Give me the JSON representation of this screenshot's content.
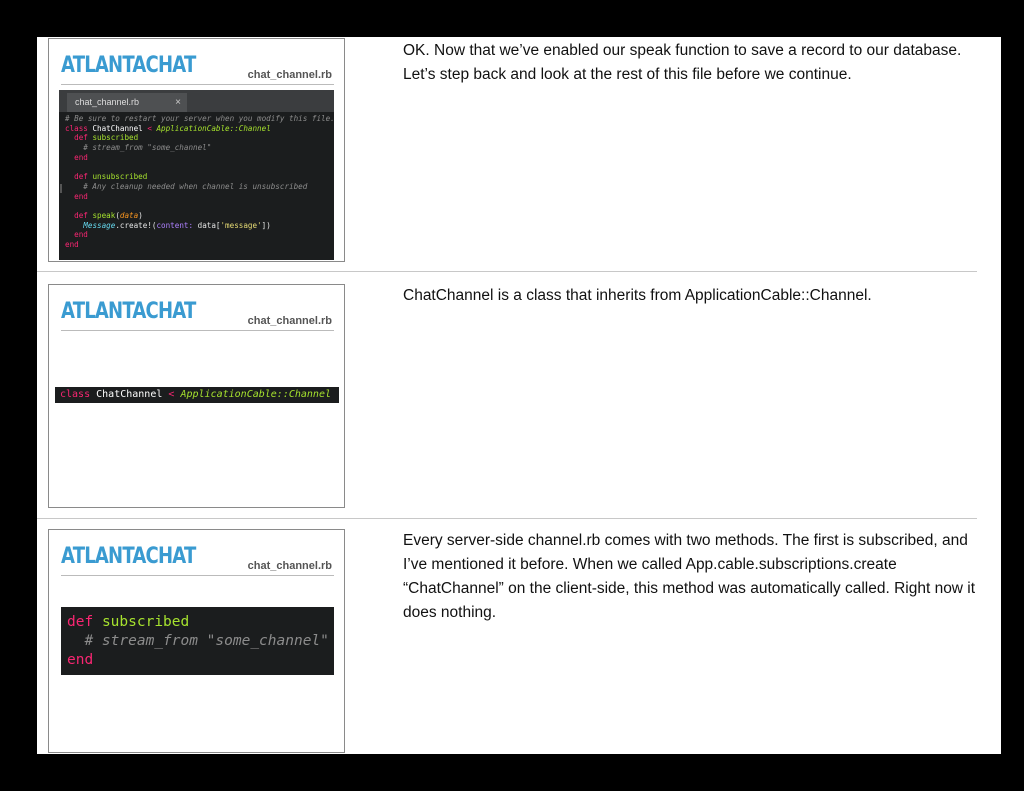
{
  "slides": [
    {
      "brand": "ATLANTACHAT",
      "filename": "chat_channel.rb",
      "editor_tab": "chat_channel.rb",
      "tab_close": "×",
      "code_lines": [
        "# Be sure to restart your server when you modify this file.",
        "class ChatChannel < ApplicationCable::Channel",
        "  def subscribed",
        "    # stream_from \"some_channel\"",
        "  end",
        "",
        "  def unsubscribed",
        "    # Any cleanup needed when channel is unsubscribed",
        "  end",
        "",
        "  def speak(data)",
        "    Message.create!(content: data['message'])",
        "  end",
        "end"
      ],
      "notes": "OK.  Now that we’ve enabled our speak function to save a record to our database. Let’s step back and look at the rest of this file before we continue."
    },
    {
      "brand": "ATLANTACHAT",
      "filename": "chat_channel.rb",
      "code_line": "class ChatChannel < ApplicationCable::Channel",
      "notes": "ChatChannel is a class that inherits from ApplicationCable::Channel."
    },
    {
      "brand": "ATLANTACHAT",
      "filename": "chat_channel.rb",
      "code_lines": [
        "def subscribed",
        "  # stream_from \"some_channel\"",
        "end"
      ],
      "notes": "Every server-side channel.rb comes with two methods. The first is subscribed, and I’ve mentioned it before. When we called App.cable.subscriptions.create “ChatChannel” on the client-side, this method was automatically called. Right now it does nothing."
    }
  ]
}
